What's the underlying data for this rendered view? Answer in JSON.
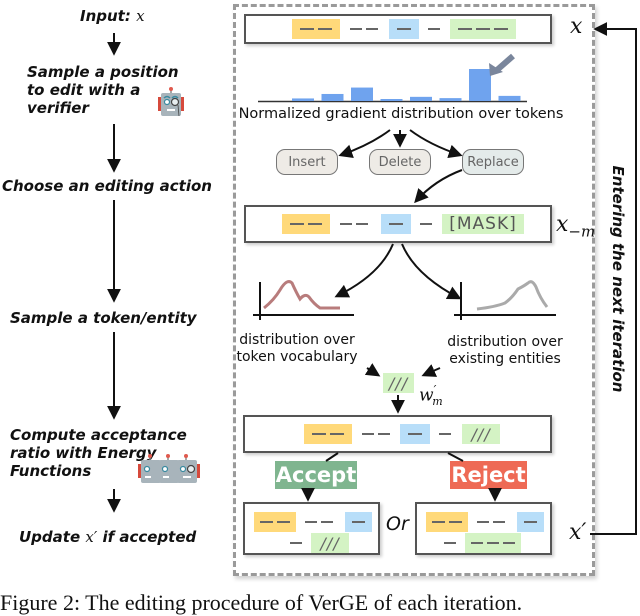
{
  "steps": {
    "input": {
      "label": "Input:",
      "var": "x"
    },
    "sample_position": {
      "line1": "Sample a position",
      "line2": "to edit with a",
      "line3": "verifier"
    },
    "choose_action": "Choose an editing action",
    "sample_token": "Sample a token/entity",
    "compute_ratio": {
      "line1": "Compute acceptance",
      "line2": "ratio with Energy",
      "line3": "Functions"
    },
    "update": {
      "prefix": "Update",
      "var": "x′",
      "suffix": "if accepted"
    }
  },
  "icons": {
    "verifier": "robot-with-monocle-icon",
    "energy_functions": "robot-group-icon"
  },
  "sequence_top": {
    "var": "x",
    "tokens": [
      {
        "type": "yellow",
        "content": "dash2"
      },
      {
        "type": "plain",
        "content": "dash2"
      },
      {
        "type": "blue",
        "content": "dash1"
      },
      {
        "type": "plain",
        "content": "dash1"
      },
      {
        "type": "green",
        "content": "dash3"
      }
    ]
  },
  "gradient_chart": {
    "label": "Normalized gradient distribution over tokens",
    "values": [
      0.08,
      0.22,
      0.42,
      0.06,
      0.13,
      0.09,
      1.0,
      0.16
    ],
    "highlighted_index": 6,
    "bar_color": "#6fa3ee"
  },
  "actions": {
    "insert": "Insert",
    "delete": "Delete",
    "replace": "Replace"
  },
  "sequence_masked": {
    "var": "x",
    "var_sub": "−m",
    "mask_label": "[MASK]"
  },
  "distributions": {
    "vocab": {
      "line1": "distribution over",
      "line2": "token vocabulary",
      "color": "#b87c7c"
    },
    "entities": {
      "line1": "distribution over",
      "line2": "existing entities",
      "color": "#aaaaaa"
    }
  },
  "sampled_token": {
    "content": "///",
    "var": "w",
    "var_sup": "′",
    "var_sub": "m"
  },
  "decisions": {
    "accept": {
      "label": "Accept",
      "color": "#7fb58f"
    },
    "reject": {
      "label": "Reject",
      "color": "#ee6a55"
    }
  },
  "or_label": "Or",
  "output_var": "x′",
  "loop_label": "Entering the next iteration",
  "caption": "Figure 2: The editing procedure of VerGE of each iteration."
}
